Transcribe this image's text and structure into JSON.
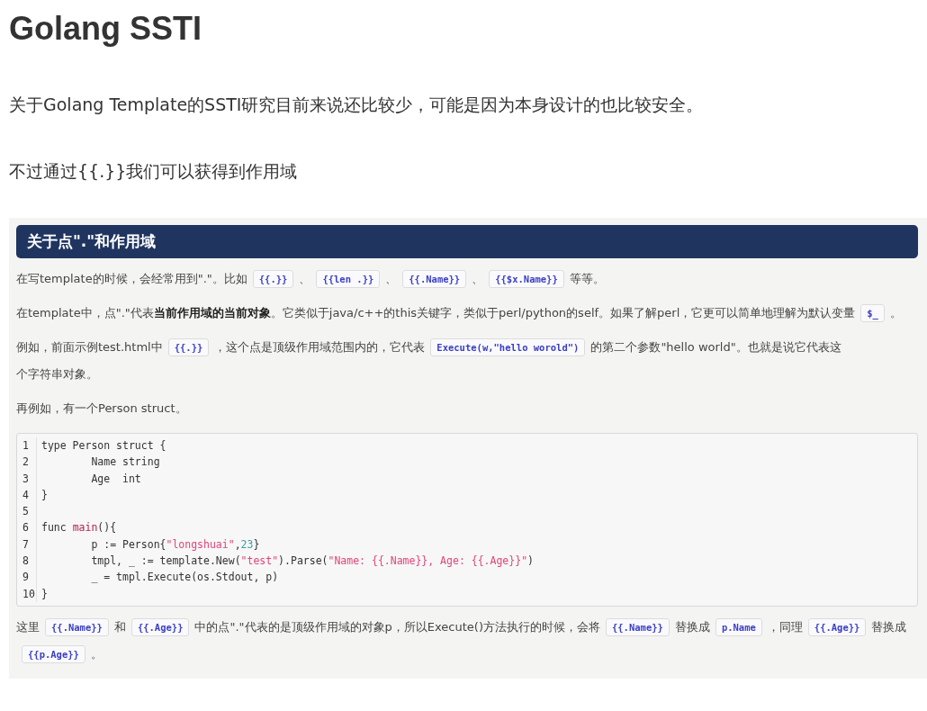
{
  "title": "Golang SSTI",
  "intro": [
    "关于Golang Template的SSTI研究目前来说还比较少，可能是因为本身设计的也比较安全。",
    "不过通过{{.}}我们可以获得到作用域"
  ],
  "figure": {
    "heading": "关于点\".\"和作用域",
    "paragraphs": [
      [
        {
          "kind": "text",
          "text": "在写template的时候，会经常用到\".\"。比如"
        },
        {
          "kind": "code",
          "text": "{{.}}"
        },
        {
          "kind": "text",
          "text": "、"
        },
        {
          "kind": "code",
          "text": "{{len .}}"
        },
        {
          "kind": "text",
          "text": "、"
        },
        {
          "kind": "code",
          "text": "{{.Name}}"
        },
        {
          "kind": "text",
          "text": "、"
        },
        {
          "kind": "code",
          "text": "{{$x.Name}}"
        },
        {
          "kind": "text",
          "text": "等等。"
        }
      ],
      [
        {
          "kind": "text",
          "text": "在template中，点\".\"代表**当前作用域的当前对象**。它类似于java/c++的this关键字，类似于perl/python的self。如果了解perl，它更可以简单地理解为默认变"
        },
        {
          "kind": "text",
          "text": "量"
        },
        {
          "kind": "code",
          "text": "$_"
        },
        {
          "kind": "text",
          "text": "。"
        }
      ],
      [
        {
          "kind": "text",
          "text": "例如，前面示例test.html中"
        },
        {
          "kind": "code",
          "text": "{{.}}"
        },
        {
          "kind": "text",
          "text": "，这个点是顶级作用域范围内的，它代表"
        },
        {
          "kind": "code",
          "text": "Execute(w,\"hello worold\")"
        },
        {
          "kind": "text",
          "text": "的第二个参数\"hello world\"。也就是说它代表这"
        },
        {
          "kind": "text",
          "text": "个字符串对象。"
        }
      ],
      [
        {
          "kind": "text",
          "text": "再例如，有一个Person struct。"
        }
      ]
    ],
    "code": [
      {
        "number": "1",
        "tokens": [
          {
            "kind": "plain",
            "text": "type Person struct {"
          }
        ]
      },
      {
        "number": "2",
        "tokens": [
          {
            "kind": "plain",
            "text": "\tName string"
          }
        ]
      },
      {
        "number": "3",
        "tokens": [
          {
            "kind": "plain",
            "text": "\tAge  int"
          }
        ]
      },
      {
        "number": "4",
        "tokens": [
          {
            "kind": "plain",
            "text": "}"
          }
        ]
      },
      {
        "number": "5"
      },
      {
        "number": "6",
        "tokens": [
          {
            "kind": "plain",
            "text": "func "
          },
          {
            "kind": "func",
            "text": "main"
          },
          {
            "kind": "plain",
            "text": "(){"
          }
        ]
      },
      {
        "number": "7",
        "tokens": [
          {
            "kind": "plain",
            "text": "\tp := Person{"
          },
          {
            "kind": "string",
            "text": "\"longshuai\""
          },
          {
            "kind": "plain",
            "text": ","
          },
          {
            "kind": "number",
            "text": "23"
          },
          {
            "kind": "plain",
            "text": "}"
          }
        ]
      },
      {
        "number": "8",
        "tokens": [
          {
            "kind": "plain",
            "text": "\ttmpl, _ := template.New("
          },
          {
            "kind": "string",
            "text": "\"test\""
          },
          {
            "kind": "plain",
            "text": ").Parse("
          },
          {
            "kind": "string",
            "text": "\"Name: {{.Name}}, Age: {{.Age}}\""
          },
          {
            "kind": "plain",
            "text": ")"
          }
        ]
      },
      {
        "number": "9",
        "tokens": [
          {
            "kind": "plain",
            "text": "\t_ = tmpl.Execute(os.Stdout, p)"
          }
        ]
      },
      {
        "number": "10",
        "tokens": [
          {
            "kind": "plain",
            "text": "}"
          }
        ]
      }
    ],
    "after": [
      [
        {
          "kind": "text",
          "text": "这里"
        },
        {
          "kind": "code",
          "text": "{{.Name}}"
        },
        {
          "kind": "text",
          "text": "和"
        },
        {
          "kind": "code",
          "text": "{{.Age}}"
        },
        {
          "kind": "text",
          "text": "中的点\".\"代表的是顶级作用域的对象p，所以Execute()方法执行的时候，会将"
        },
        {
          "kind": "code",
          "text": "{{.Name}}"
        },
        {
          "kind": "text",
          "text": "替换成"
        },
        {
          "kind": "code",
          "text": "p.Name"
        },
        {
          "kind": "text",
          "text": "，同理"
        },
        {
          "kind": "code",
          "text": "{{.Age}}"
        },
        {
          "kind": "text",
          "text": "替换成"
        },
        {
          "kind": "code",
          "text": "{{p.Age}}"
        },
        {
          "kind": "text",
          "text": "。"
        }
      ]
    ]
  }
}
